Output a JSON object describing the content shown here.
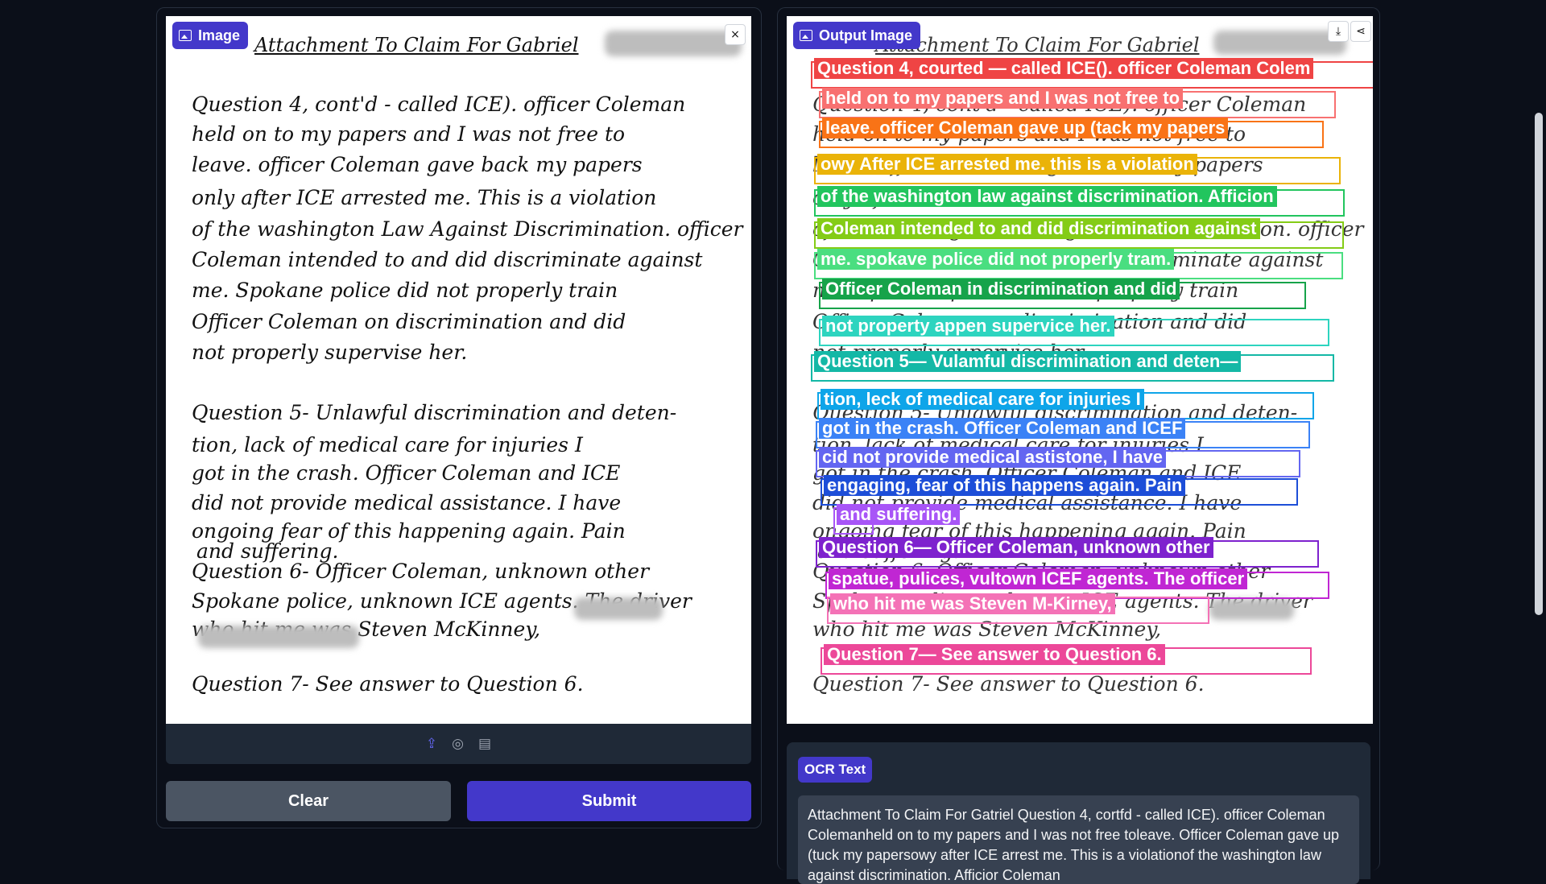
{
  "input_panel": {
    "label": "Image",
    "close_icon": "×",
    "handwriting": [
      "Attachment To Claim For Gabriel",
      "Question 4, cont'd - called ICE). officer Coleman",
      "held on to my papers and I was not free to",
      "leave. officer Coleman gave back my papers",
      "only after ICE arrested me. This is a violation",
      "of the washington Law Against Discrimination. officer",
      "Coleman intended to and did discriminate against",
      "me. Spokane police did not properly train",
      "Officer Coleman on discrimination and did",
      "not properly supervise her.",
      "Question 5- Unlawful discrimination and deten-",
      "tion, lack of medical care for injuries I",
      "got in the crash. Officer Coleman and ICE",
      "did not provide medical assistance. I have",
      "ongoing fear of this happening again. Pain",
      "and suffering.",
      "Question 6- Officer Coleman, unknown other",
      "Spokane police, unknown ICE agents. The driver",
      "who hit me was Steven McKinney,",
      "Question 7- See answer to Question 6."
    ],
    "toolbar_icons": [
      "upload-icon",
      "webcam-icon",
      "clipboard-icon"
    ],
    "clear_label": "Clear",
    "submit_label": "Submit"
  },
  "output_panel": {
    "label": "Output Image",
    "download_icon": "⤓",
    "share_icon": "⋖",
    "ocr_lines": [
      {
        "text": "Question 4, courted — called ICE(). officer Coleman Colem",
        "color": "#ef4444"
      },
      {
        "text": "held on to my papers and I was not free to",
        "color": "#f87171"
      },
      {
        "text": "leave. officer Coleman gave up (tack my papers",
        "color": "#f97316"
      },
      {
        "text": "owy After ICE arrested me. this is a violation",
        "color": "#eab308"
      },
      {
        "text": "of the washington law against discrimination. Afficion",
        "color": "#22c55e"
      },
      {
        "text": "Coleman intended to and did discrimination against",
        "color": "#84cc16"
      },
      {
        "text": "me. spokave police did not properly tram.",
        "color": "#4ade80"
      },
      {
        "text": "Officer Coleman in discrimination and did",
        "color": "#16a34a"
      },
      {
        "text": "not property appen supervice her.",
        "color": "#2dd4bf"
      },
      {
        "text": "Question 5— Vulamful discrimination and deten—",
        "color": "#14b8a6"
      },
      {
        "text": "tion, leck of medical care for injuries I",
        "color": "#0ea5e9"
      },
      {
        "text": "got in the crash. Officer Coleman and ICEF",
        "color": "#3b82f6"
      },
      {
        "text": "cid not provide medical astistone, I have",
        "color": "#6366f1"
      },
      {
        "text": "engaging, fear of this happens again. Pain",
        "color": "#1d4ed8"
      },
      {
        "text": "and suffering.",
        "color": "#a855f7"
      },
      {
        "text": "Question 6— Officer Coleman, unknown other",
        "color": "#7e22ce"
      },
      {
        "text": "spatue, pulices, vultown ICEF agents. The officer",
        "color": "#c026d3"
      },
      {
        "text": "who hit me was Steven M-Kirney,",
        "color": "#f472b6"
      },
      {
        "text": "Question 7— See answer to Question 6.",
        "color": "#ec4899"
      }
    ],
    "ocr_section_label": "OCR Text",
    "ocr_text": "Attachment To Claim For Gatriel Question 4, cortfd - called ICE). officer Coleman Colemanheld on to my papers and I was not free toleave. Officer Coleman gave up (tuck my papersowy after ICE arrest me. This is a violationof the washington law against discrimination. Afficior Coleman"
  }
}
